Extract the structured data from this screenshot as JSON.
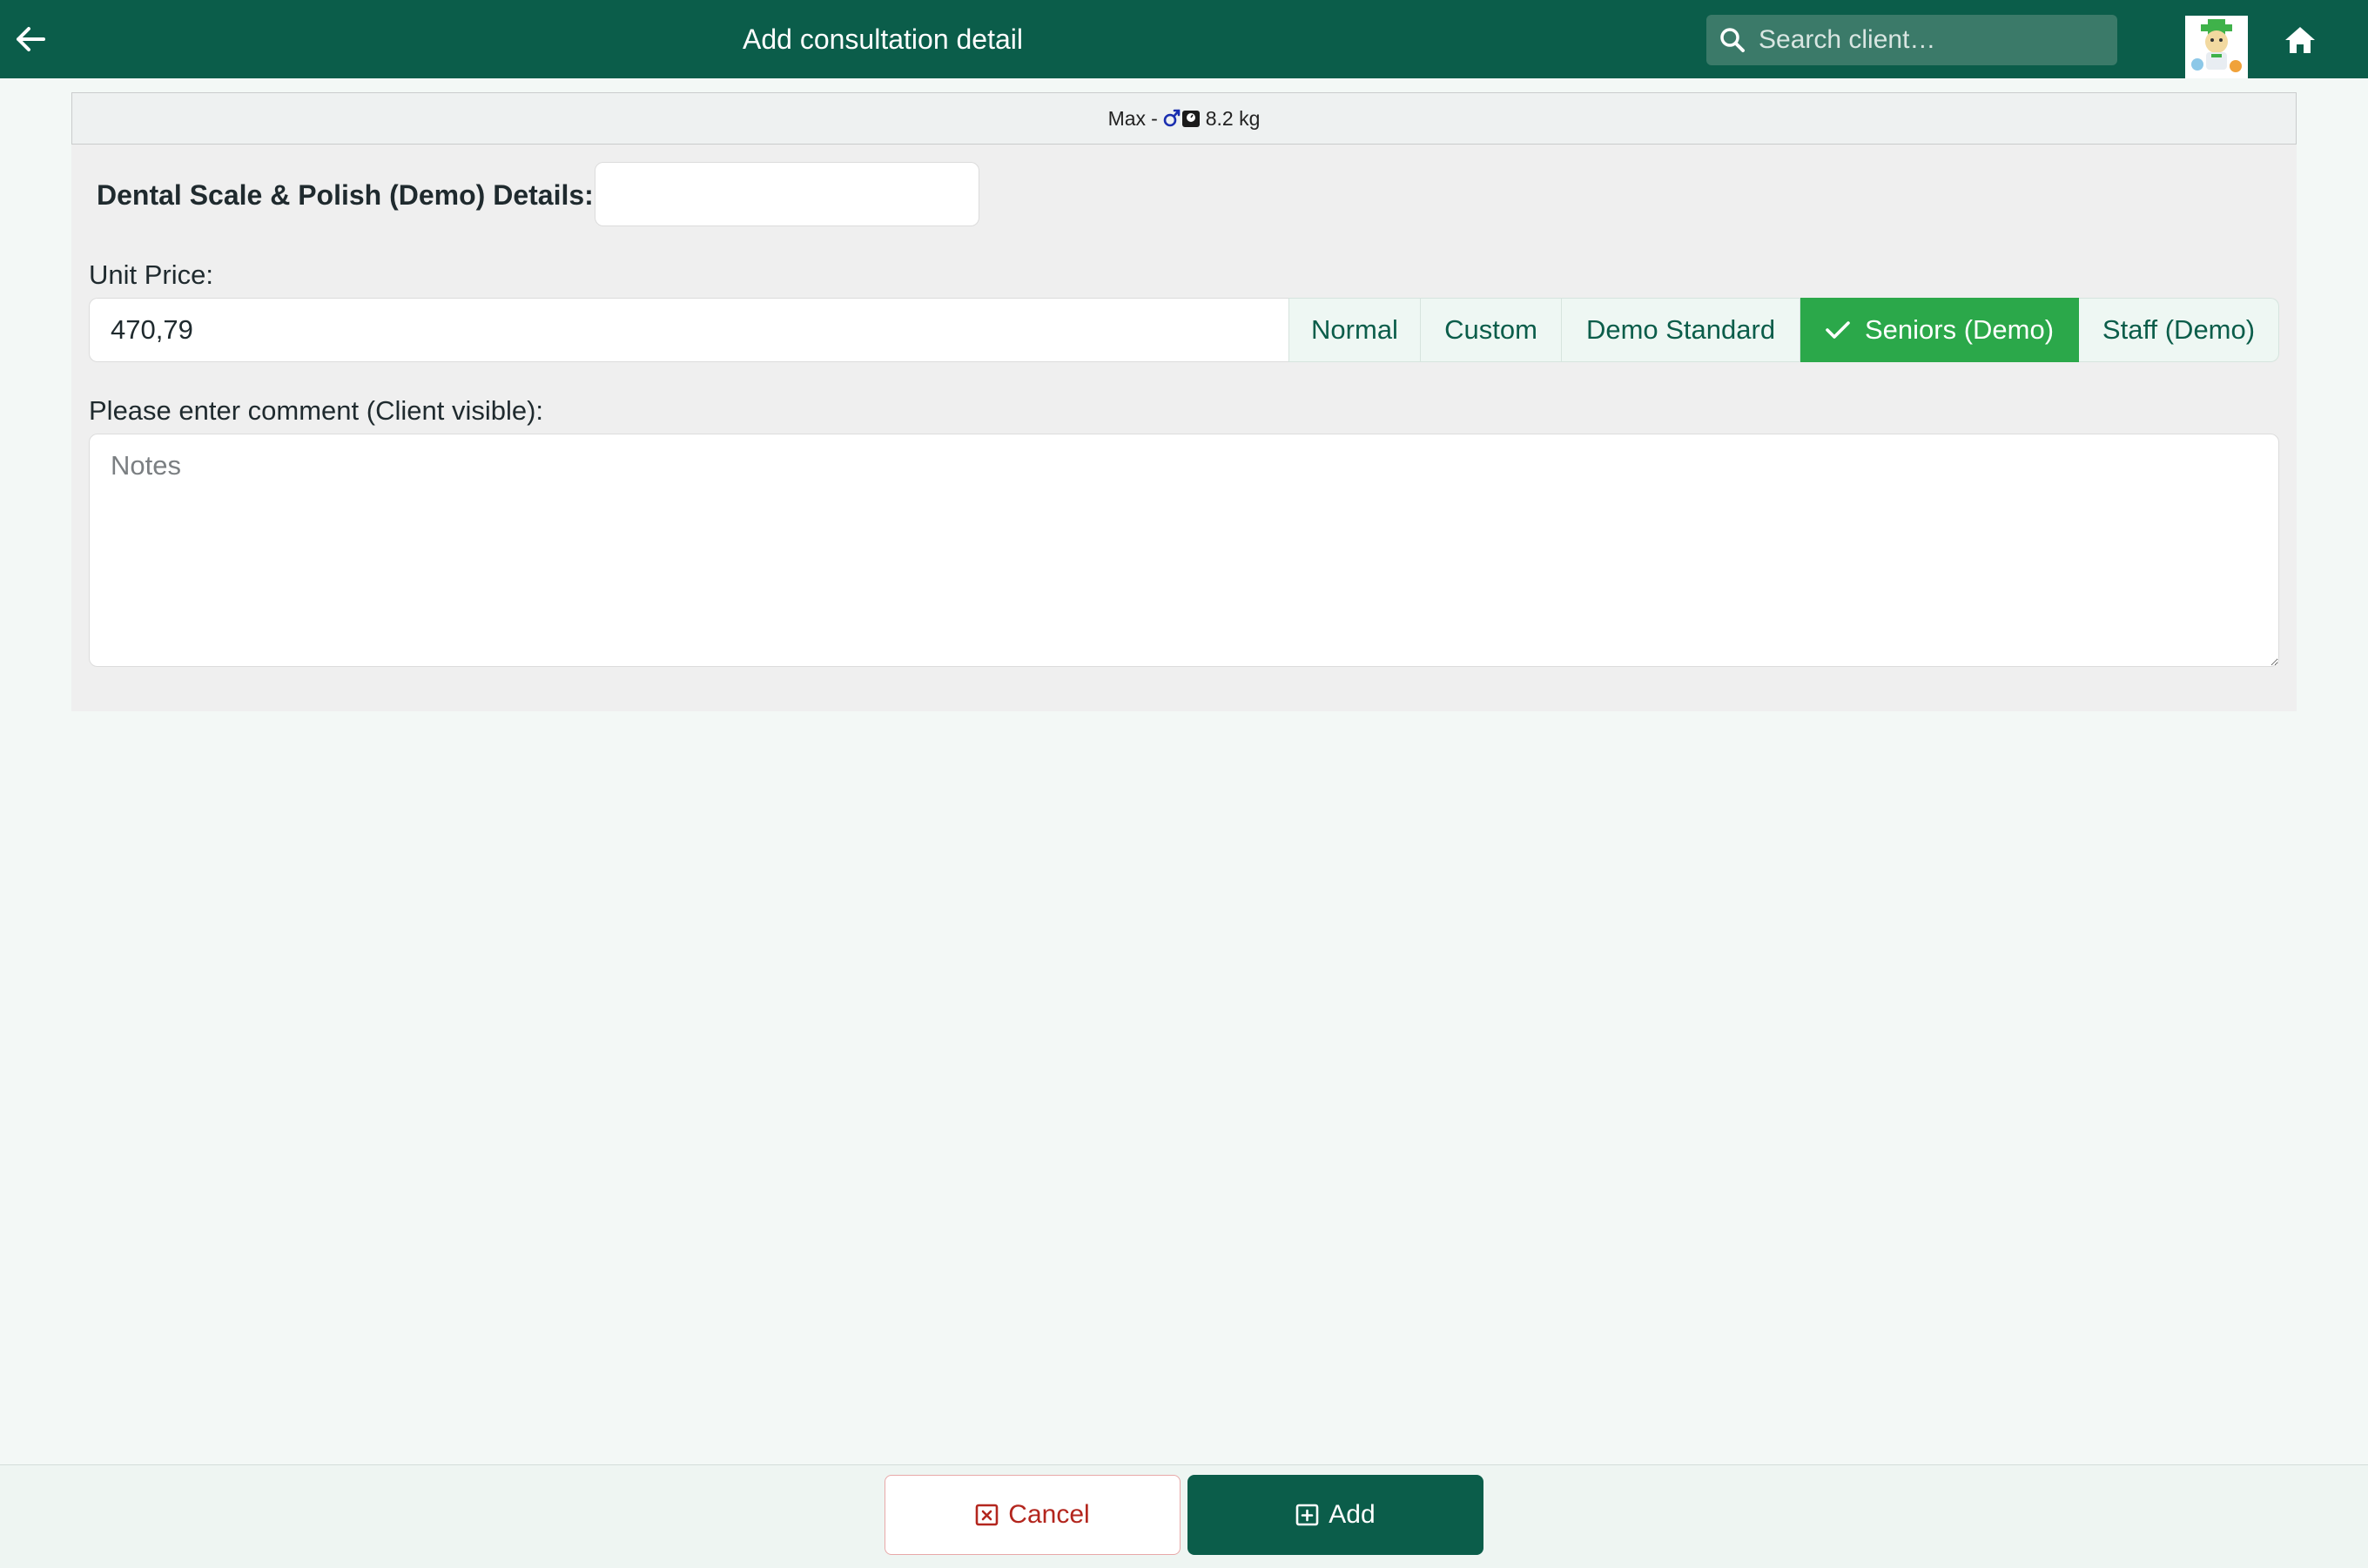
{
  "header": {
    "title": "Add consultation detail",
    "search_placeholder": "Search client…"
  },
  "patient": {
    "name": "Max",
    "separator": "-",
    "sex_icon": "male-symbol-icon",
    "weight_icon": "scale-icon",
    "weight": "8.2 kg"
  },
  "form": {
    "details_label": "Dental Scale & Polish (Demo) Details:",
    "details_value": "",
    "unit_price_label": "Unit Price:",
    "unit_price_value": "470,79",
    "price_options": [
      {
        "label": "Normal",
        "selected": false
      },
      {
        "label": "Custom",
        "selected": false
      },
      {
        "label": "Demo Standard",
        "selected": false
      },
      {
        "label": "Seniors (Demo)",
        "selected": true
      },
      {
        "label": "Staff (Demo)",
        "selected": false
      }
    ],
    "comment_label": "Please enter comment (Client visible):",
    "comment_placeholder": "Notes",
    "comment_value": ""
  },
  "footer": {
    "cancel_label": "Cancel",
    "add_label": "Add"
  },
  "colors": {
    "brand": "#0b5d4a",
    "selected": "#2ba84a",
    "cancel": "#b3261e"
  }
}
